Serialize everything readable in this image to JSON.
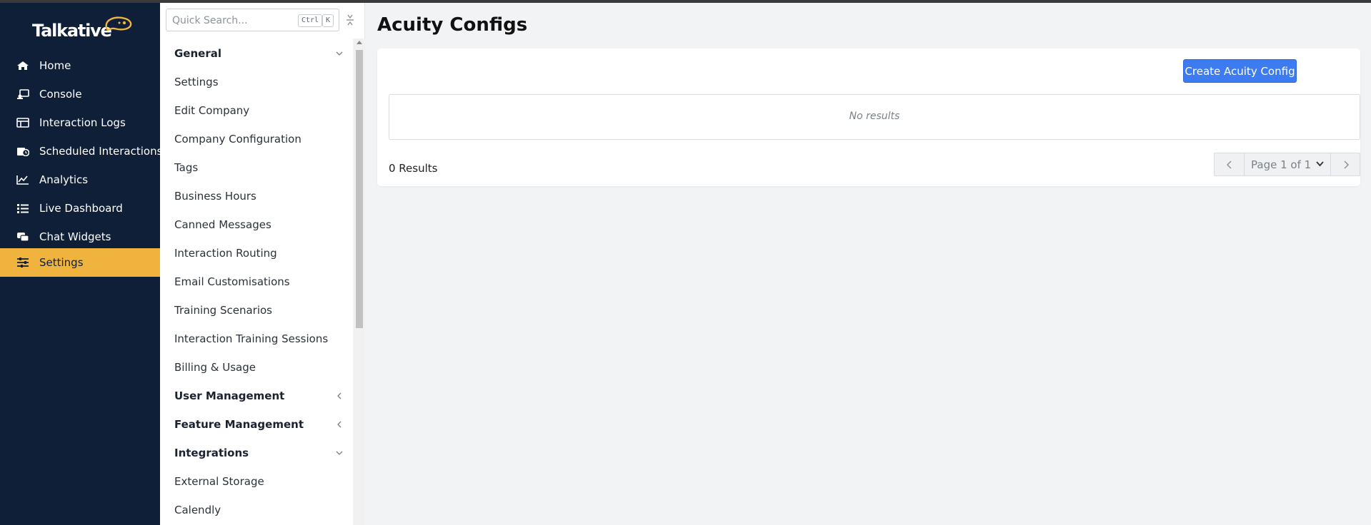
{
  "app": {
    "brand": "Talkative",
    "brand_color": "#f0b33d",
    "nav_bg": "#0f1f38"
  },
  "nav": {
    "items": [
      {
        "label": "Home",
        "icon": "home-icon"
      },
      {
        "label": "Console",
        "icon": "console-icon"
      },
      {
        "label": "Interaction Logs",
        "icon": "interaction-logs-icon"
      },
      {
        "label": "Scheduled Interactions",
        "icon": "calendar-clock-icon"
      },
      {
        "label": "Analytics",
        "icon": "analytics-icon"
      },
      {
        "label": "Live Dashboard",
        "icon": "dashboard-list-icon"
      },
      {
        "label": "Chat Widgets",
        "icon": "chat-bubbles-icon"
      },
      {
        "label": "Settings",
        "icon": "sliders-icon",
        "active": true
      }
    ]
  },
  "submenu": {
    "search": {
      "placeholder": "Quick Search...",
      "shortcut_ctrl": "Ctrl",
      "shortcut_key": "K"
    },
    "items": [
      {
        "label": "General",
        "section": true,
        "chevron": "down"
      },
      {
        "label": "Settings"
      },
      {
        "label": "Edit Company"
      },
      {
        "label": "Company Configuration"
      },
      {
        "label": "Tags"
      },
      {
        "label": "Business Hours"
      },
      {
        "label": "Canned Messages"
      },
      {
        "label": "Interaction Routing"
      },
      {
        "label": "Email Customisations"
      },
      {
        "label": "Training Scenarios"
      },
      {
        "label": "Interaction Training Sessions"
      },
      {
        "label": "Billing & Usage"
      },
      {
        "label": "User Management",
        "section": true,
        "chevron": "left"
      },
      {
        "label": "Feature Management",
        "section": true,
        "chevron": "left"
      },
      {
        "label": "Integrations",
        "section": true,
        "chevron": "down"
      },
      {
        "label": "External Storage"
      },
      {
        "label": "Calendly"
      }
    ]
  },
  "main": {
    "title": "Acuity Configs",
    "create_button": "Create Acuity Config",
    "empty_text": "No results",
    "results_count": "0 Results",
    "pagination": {
      "page_label": "Page 1 of 1"
    },
    "accent_color": "#3d7cf0"
  }
}
